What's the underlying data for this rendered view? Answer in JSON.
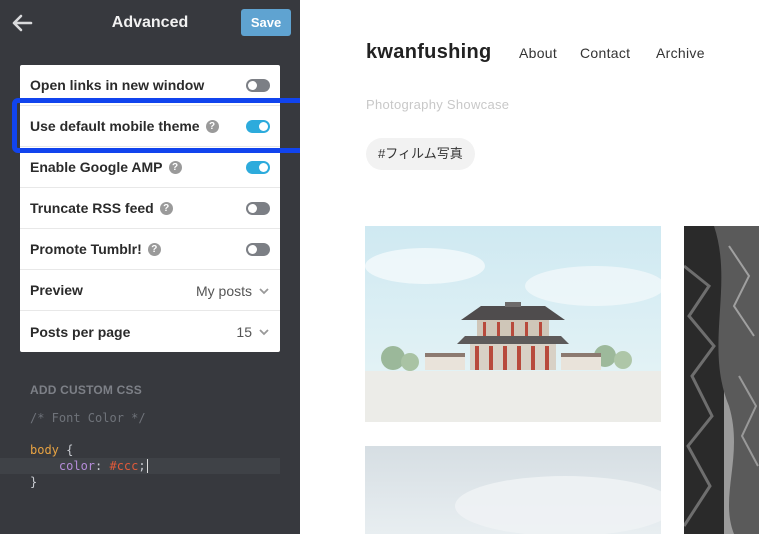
{
  "sidebar": {
    "title": "Advanced",
    "save_label": "Save",
    "settings": [
      {
        "label": "Open links in new window",
        "help": false,
        "type": "toggle",
        "on": false
      },
      {
        "label": "Use default mobile theme",
        "help": true,
        "type": "toggle",
        "on": true
      },
      {
        "label": "Enable Google AMP",
        "help": true,
        "type": "toggle",
        "on": true
      },
      {
        "label": "Truncate RSS feed",
        "help": true,
        "type": "toggle",
        "on": false
      },
      {
        "label": "Promote Tumblr!",
        "help": true,
        "type": "toggle",
        "on": false
      },
      {
        "label": "Preview",
        "type": "select",
        "value": "My posts"
      },
      {
        "label": "Posts per page",
        "type": "select",
        "value": "15"
      }
    ],
    "help_glyph": "?",
    "custom_css_title": "ADD CUSTOM CSS",
    "css_lines": {
      "comment": "/* Font Color */",
      "selector": "body",
      "open_brace": " {",
      "property": "color",
      "colon": ": ",
      "value": "#ccc",
      "semicolon": ";",
      "close_brace": "}"
    }
  },
  "blog": {
    "title": "kwanfushing",
    "nav": [
      "About",
      "Contact",
      "Archive"
    ],
    "description": "Photography Showcase",
    "tag": "#フィルム写真"
  },
  "colors": {
    "sidebar_bg": "#37393e",
    "accent_blue": "#2dabdc",
    "save_blue": "#5fa3d1",
    "highlight": "#1144ee"
  },
  "icons": {
    "back": "arrow-left-icon",
    "chevron": "chevron-down-icon",
    "help": "question-circle-icon"
  }
}
